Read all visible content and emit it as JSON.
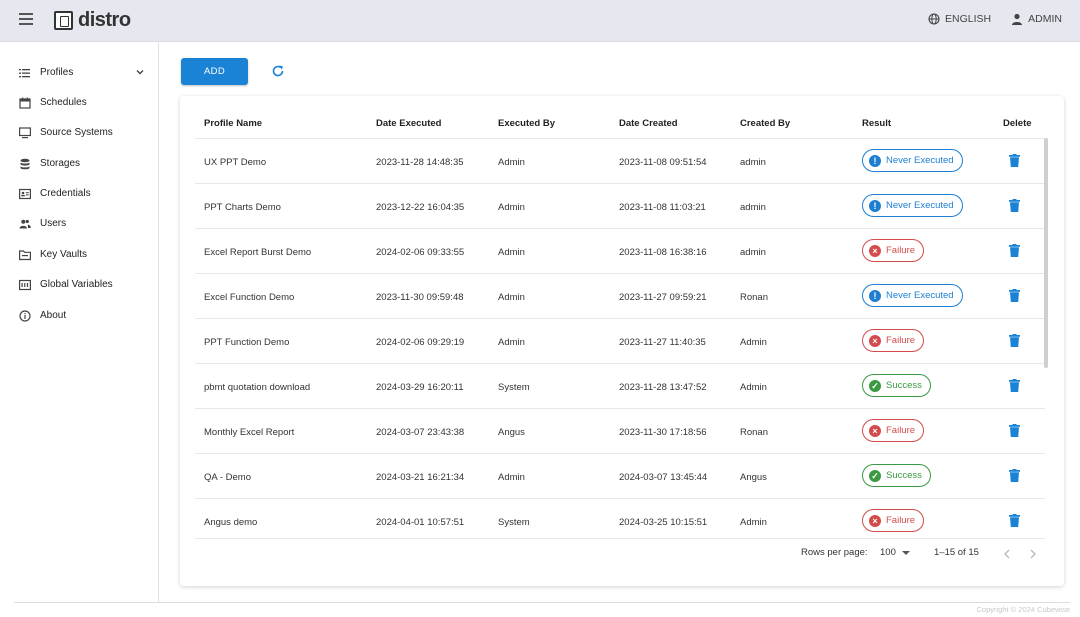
{
  "app": {
    "name": "distro"
  },
  "header": {
    "language": "ENGLISH",
    "user": "ADMIN"
  },
  "sidebar": {
    "items": [
      {
        "label": "Profiles",
        "icon": "list-icon"
      },
      {
        "label": "Schedules",
        "icon": "calendar-icon"
      },
      {
        "label": "Source Systems",
        "icon": "monitor-icon"
      },
      {
        "label": "Storages",
        "icon": "database-icon"
      },
      {
        "label": "Credentials",
        "icon": "id-card-icon"
      },
      {
        "label": "Users",
        "icon": "users-icon"
      },
      {
        "label": "Key Vaults",
        "icon": "folder-icon"
      },
      {
        "label": "Global Variables",
        "icon": "variables-icon"
      },
      {
        "label": "About",
        "icon": "info-icon"
      }
    ]
  },
  "toolbar": {
    "add_label": "ADD"
  },
  "table": {
    "headers": {
      "profile_name": "Profile Name",
      "date_executed": "Date Executed",
      "executed_by": "Executed By",
      "date_created": "Date Created",
      "created_by": "Created By",
      "result": "Result",
      "delete": "Delete"
    },
    "rows": [
      {
        "name": "UX PPT Demo",
        "executed": "2023-11-28 14:48:35",
        "executed_by": "Admin",
        "created": "2023-11-08 09:51:54",
        "created_by": "admin",
        "result": "Never Executed",
        "status": "never"
      },
      {
        "name": "PPT Charts Demo",
        "executed": "2023-12-22 16:04:35",
        "executed_by": "Admin",
        "created": "2023-11-08 11:03:21",
        "created_by": "admin",
        "result": "Never Executed",
        "status": "never"
      },
      {
        "name": "Excel Report Burst Demo",
        "executed": "2024-02-06 09:33:55",
        "executed_by": "Admin",
        "created": "2023-11-08 16:38:16",
        "created_by": "admin",
        "result": "Failure",
        "status": "failure"
      },
      {
        "name": "Excel Function Demo",
        "executed": "2023-11-30 09:59:48",
        "executed_by": "Admin",
        "created": "2023-11-27 09:59:21",
        "created_by": "Ronan",
        "result": "Never Executed",
        "status": "never"
      },
      {
        "name": "PPT Function Demo",
        "executed": "2024-02-06 09:29:19",
        "executed_by": "Admin",
        "created": "2023-11-27 11:40:35",
        "created_by": "Admin",
        "result": "Failure",
        "status": "failure"
      },
      {
        "name": "pbmt quotation download",
        "executed": "2024-03-29 16:20:11",
        "executed_by": "System",
        "created": "2023-11-28 13:47:52",
        "created_by": "Admin",
        "result": "Success",
        "status": "success"
      },
      {
        "name": "Monthly Excel Report",
        "executed": "2024-03-07 23:43:38",
        "executed_by": "Angus",
        "created": "2023-11-30 17:18:56",
        "created_by": "Ronan",
        "result": "Failure",
        "status": "failure"
      },
      {
        "name": "QA - Demo",
        "executed": "2024-03-21 16:21:34",
        "executed_by": "Admin",
        "created": "2024-03-07 13:45:44",
        "created_by": "Angus",
        "result": "Success",
        "status": "success"
      },
      {
        "name": "Angus demo",
        "executed": "2024-04-01 10:57:51",
        "executed_by": "System",
        "created": "2024-03-25 10:15:51",
        "created_by": "Admin",
        "result": "Failure",
        "status": "failure"
      }
    ]
  },
  "pagination": {
    "rows_label": "Rows per page:",
    "rows_value": "100",
    "range": "1–15 of 15"
  },
  "footer": {
    "copyright": "Copyright © 2024 Cubewise"
  },
  "colors": {
    "primary": "#1b83d6",
    "never": "#1e7fd2",
    "failure": "#d34b4b",
    "success": "#3a9a43",
    "header_bg": "#e5e8ef"
  }
}
